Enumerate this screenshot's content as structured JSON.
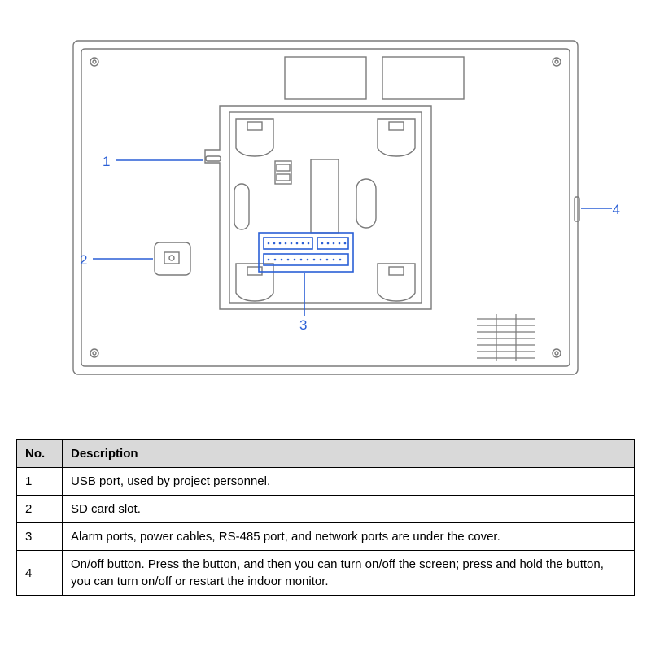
{
  "callouts": {
    "c1": "1",
    "c2": "2",
    "c3": "3",
    "c4": "4"
  },
  "table": {
    "headers": {
      "no": "No.",
      "desc": "Description"
    },
    "rows": [
      {
        "no": "1",
        "desc": "USB port, used by project personnel."
      },
      {
        "no": "2",
        "desc": "SD card slot."
      },
      {
        "no": "3",
        "desc": "Alarm ports, power cables, RS-485 port, and network ports are under the cover."
      },
      {
        "no": "4",
        "desc": "On/off button. Press the button, and then you can turn on/off the screen; press and hold the button, you can turn on/off or restart the indoor monitor."
      }
    ]
  }
}
